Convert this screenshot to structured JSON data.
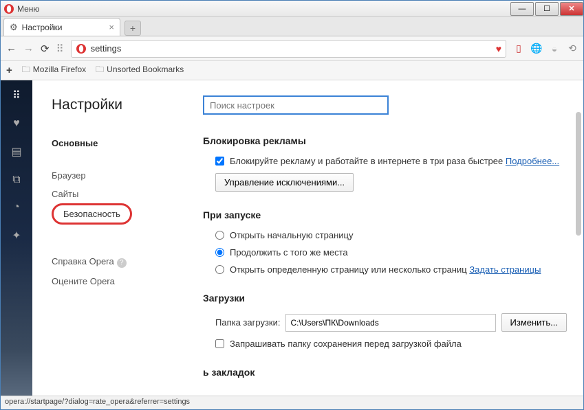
{
  "titlebar": {
    "menu_label": "Меню"
  },
  "tab": {
    "title": "Настройки"
  },
  "url": {
    "value": "settings"
  },
  "bookmarks": {
    "folder1": "Mozilla Firefox",
    "folder2": "Unsorted Bookmarks"
  },
  "sidebar": {
    "title": "Настройки",
    "items": [
      "Основные",
      "Браузер",
      "Сайты",
      "Безопасность"
    ],
    "help": "Справка Opera",
    "rate": "Оцените Opera"
  },
  "search": {
    "placeholder": "Поиск настроек"
  },
  "sections": {
    "adblock": {
      "title": "Блокировка рекламы",
      "check_label": "Блокируйте рекламу и работайте в интернете в три раза быстрее",
      "learn_more": "Подробнее...",
      "exceptions_btn": "Управление исключениями..."
    },
    "startup": {
      "title": "При запуске",
      "opt1": "Открыть начальную страницу",
      "opt2": "Продолжить с того же места",
      "opt3": "Открыть определенную страницу или несколько страниц",
      "set_pages": "Задать страницы"
    },
    "downloads": {
      "title": "Загрузки",
      "folder_label": "Папка загрузки:",
      "folder_value": "C:\\Users\\ПК\\Downloads",
      "change_btn": "Изменить...",
      "ask_label": "Запрашивать папку сохранения перед загрузкой файла"
    },
    "bookmarks_panel": {
      "title_partial": "ь закладок"
    }
  },
  "statusbar": {
    "text": "opera://startpage/?dialog=rate_opera&referrer=settings"
  }
}
